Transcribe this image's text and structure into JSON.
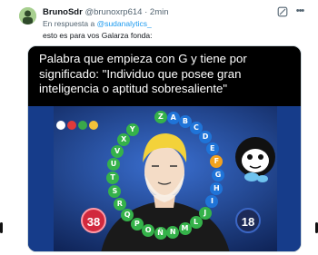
{
  "tweet": {
    "display_name": "BrunoSdr",
    "handle": "@brunoxrp614",
    "separator": "·",
    "time": "2min",
    "reply_prefix": "En respuesta a",
    "reply_to": "@sudanalytics_",
    "text": "esto es para vos Galarza fonda:"
  },
  "media": {
    "question": "Palabra que empieza con G y tiene por significado: \"Individuo que posee gran inteligencia o aptitud sobresaliente\"",
    "score_left": "38",
    "score_right": "18",
    "letters": [
      {
        "char": "Z",
        "color": "green"
      },
      {
        "char": "A",
        "color": "blue"
      },
      {
        "char": "B",
        "color": "blue"
      },
      {
        "char": "C",
        "color": "blue"
      },
      {
        "char": "D",
        "color": "blue"
      },
      {
        "char": "E",
        "color": "blue"
      },
      {
        "char": "F",
        "color": "orange"
      },
      {
        "char": "G",
        "color": "blue"
      },
      {
        "char": "H",
        "color": "blue"
      },
      {
        "char": "I",
        "color": "blue"
      },
      {
        "char": "J",
        "color": "green"
      },
      {
        "char": "L",
        "color": "green"
      },
      {
        "char": "M",
        "color": "green"
      },
      {
        "char": "N",
        "color": "green"
      },
      {
        "char": "Ñ",
        "color": "green"
      },
      {
        "char": "O",
        "color": "green"
      },
      {
        "char": "P",
        "color": "green"
      },
      {
        "char": "Q",
        "color": "green"
      },
      {
        "char": "R",
        "color": "green"
      },
      {
        "char": "S",
        "color": "green"
      },
      {
        "char": "T",
        "color": "green"
      },
      {
        "char": "U",
        "color": "green"
      },
      {
        "char": "V",
        "color": "green"
      },
      {
        "char": "X",
        "color": "green"
      },
      {
        "char": "Y",
        "color": "green"
      }
    ]
  },
  "icons": {
    "grok": "grok-icon",
    "more": "more-icon"
  },
  "colors": {
    "link": "#1d9bf0",
    "secondary_text": "#536471",
    "scene_background": "#1a3f86",
    "score_left": "#d1293d",
    "score_right": "#1d2a57"
  }
}
